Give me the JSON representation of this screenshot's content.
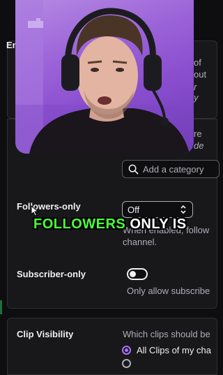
{
  "left_fragments": {
    "en": "En"
  },
  "right_fragments": [
    "of",
    "out",
    "r y",
    "re",
    "de"
  ],
  "category_search": {
    "placeholder": "Add a category"
  },
  "followers_only": {
    "label": "Followers-only",
    "selected_value": "Off",
    "description_line1": "When enabled, follow",
    "description_line2": "channel."
  },
  "subscriber_only": {
    "label": "Subscriber-only",
    "toggle_state": "off",
    "description": "Only allow subscribe"
  },
  "clip_visibility": {
    "label": "Clip Visibility",
    "description": "Which clips should be",
    "selected_option": "All Clips of my cha"
  },
  "caption": {
    "highlight": "FOLLOWERS",
    "rest": " ONLY IS"
  },
  "colors": {
    "background": "#0e0e10",
    "panel": "#18181b",
    "accent": "#a970ff",
    "caption_highlight": "#4cff3a",
    "webcam_wall": "#9b63d8"
  },
  "icons": [
    "search-icon",
    "chevron-updown-icon",
    "mouse-cursor-icon",
    "headset-icon"
  ]
}
